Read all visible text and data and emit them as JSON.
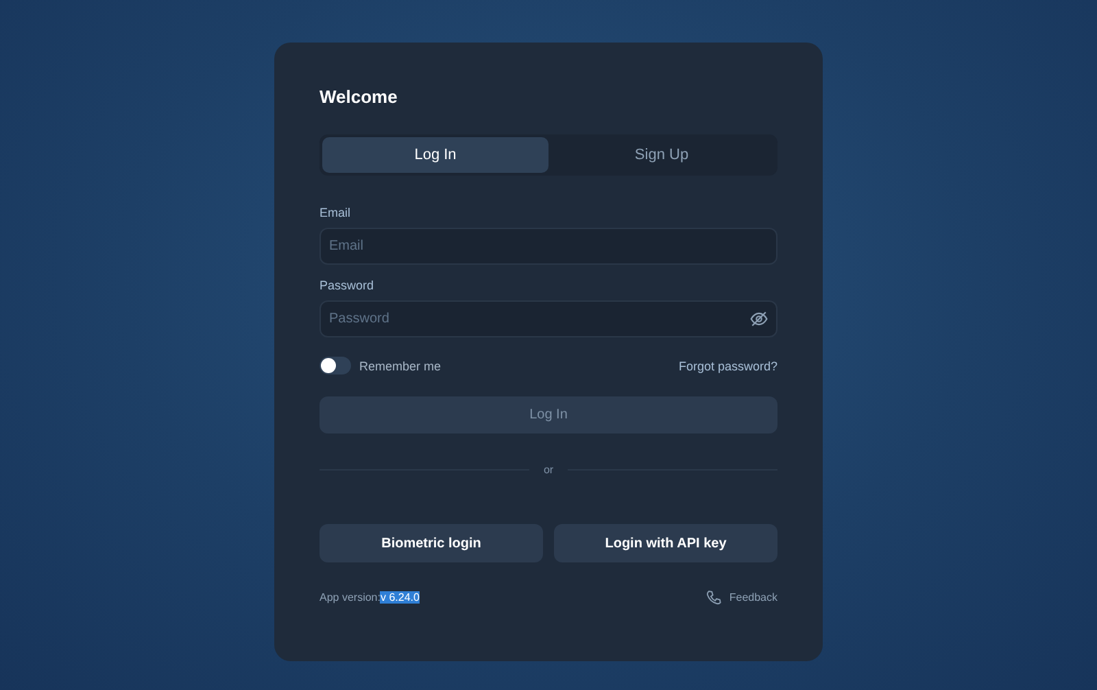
{
  "title": "Welcome",
  "tabs": [
    {
      "label": "Log In",
      "selected": true
    },
    {
      "label": "Sign Up",
      "selected": false
    }
  ],
  "fields": [
    {
      "label": "Email",
      "placeholder": "Email",
      "kind": "text"
    },
    {
      "label": "Password",
      "placeholder": "Password",
      "kind": "password"
    }
  ],
  "remember": {
    "label": "Remember me",
    "on": false
  },
  "forgot_link": "Forgot password?",
  "submit": {
    "label": "Log In",
    "disabled": true
  },
  "divider_text": "or",
  "alt_buttons": [
    "Biometric login",
    "Login with API key"
  ],
  "footer": {
    "version_label": "App version:",
    "version": "v 6.24.0",
    "version_selected": true,
    "feedback": "Feedback"
  }
}
